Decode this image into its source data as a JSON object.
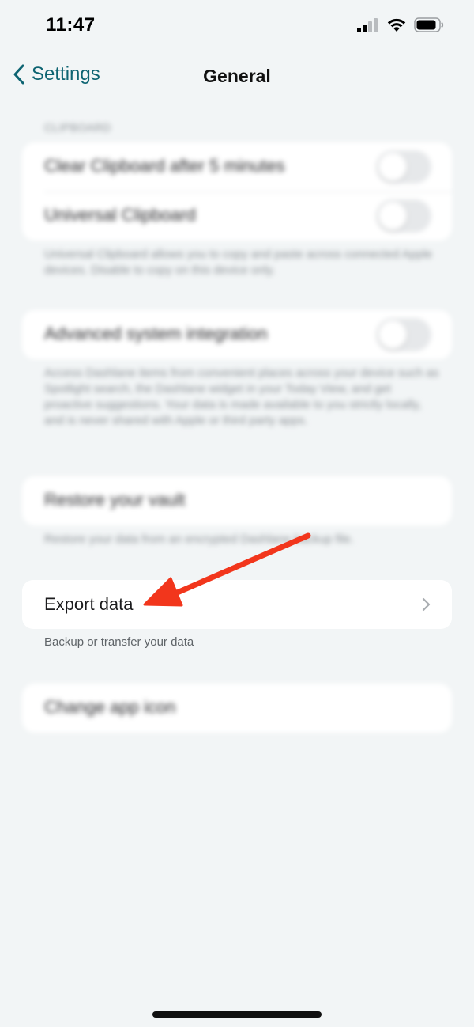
{
  "status_bar": {
    "time": "11:47"
  },
  "nav": {
    "back_label": "Settings",
    "title": "General"
  },
  "clipboard_section": {
    "header": "CLIPBOARD",
    "rows": [
      {
        "label": "Clear Clipboard after 5 minutes",
        "toggle_on": false
      },
      {
        "label": "Universal Clipboard",
        "toggle_on": false
      }
    ],
    "footnote": "Universal Clipboard allows you to copy and paste across connected Apple devices. Disable to copy on this device only."
  },
  "integration_section": {
    "row_label": "Advanced system integration",
    "toggle_on": false,
    "footnote": "Access Dashlane items from convenient places across your device such as Spotlight search, the Dashlane widget in your Today View, and get proactive suggestions. Your data is made available to you strictly locally, and is never shared with Apple or third party apps."
  },
  "restore_section": {
    "row_label": "Restore your vault",
    "footnote": "Restore your data from an encrypted Dashlane backup file."
  },
  "export_section": {
    "row_label": "Export data",
    "footnote": "Backup or transfer your data"
  },
  "app_icon_section": {
    "row_label": "Change app icon"
  },
  "colors": {
    "accent": "#0e6472",
    "annotation_arrow": "#f2361c",
    "background": "#f2f5f6",
    "card": "#ffffff"
  },
  "icons": {
    "back": "chevron-left-icon",
    "row_disclosure": "chevron-right-icon",
    "signal": "cellular-signal-icon",
    "wifi": "wifi-icon",
    "battery": "battery-icon"
  }
}
